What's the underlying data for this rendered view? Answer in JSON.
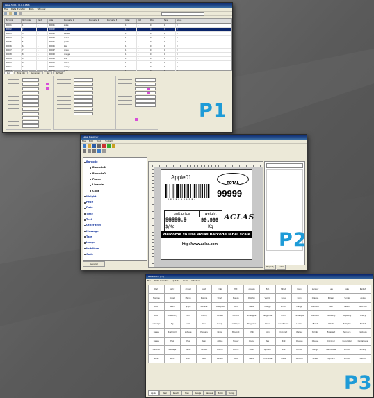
{
  "colors": {
    "background": "#5e5e5e",
    "accent_label": "#1e9bd7",
    "titlebar": "#0a246a"
  },
  "p1": {
    "label": "P1",
    "window_title": "Label.5 (P1) (6.0.0.186)",
    "menu": [
      "File",
      "Data Transfer",
      "Tools",
      "Window"
    ],
    "grid_headers": [
      "PLU code",
      "Item code",
      "Dept",
      "Code",
      "PLU name 1",
      "PLU name 2",
      "PLU name 3",
      "Index",
      "Unit",
      "Price",
      "Tare",
      "Group"
    ],
    "grid_rows": [
      [
        "000001",
        "1",
        "1",
        "000001",
        "apple",
        "",
        "",
        "1",
        "1",
        "0",
        "0",
        "0"
      ],
      [
        "000002",
        "2",
        "1",
        "000002",
        "pear",
        "",
        "",
        "1",
        "1",
        "0",
        "0",
        "0"
      ],
      [
        "000003",
        "3",
        "1",
        "000003",
        "banana",
        "",
        "",
        "1",
        "1",
        "0",
        "0",
        "0"
      ],
      [
        "000004",
        "4",
        "1",
        "000004",
        "melon",
        "",
        "",
        "1",
        "1",
        "0",
        "0",
        "0"
      ],
      [
        "000005",
        "5",
        "1",
        "000005",
        "peach",
        "",
        "",
        "1",
        "1",
        "0",
        "0",
        "0"
      ],
      [
        "000006",
        "6",
        "1",
        "000006",
        "kiwi",
        "",
        "",
        "1",
        "1",
        "0",
        "0",
        "0"
      ],
      [
        "000007",
        "7",
        "1",
        "000007",
        "grape",
        "",
        "",
        "1",
        "1",
        "0",
        "0",
        "0"
      ],
      [
        "000008",
        "8",
        "1",
        "000008",
        "orange",
        "",
        "",
        "1",
        "1",
        "0",
        "0",
        "0"
      ],
      [
        "000009",
        "9",
        "1",
        "000009",
        "lime",
        "",
        "",
        "1",
        "1",
        "0",
        "0",
        "0"
      ],
      [
        "000010",
        "10",
        "1",
        "000010",
        "lemon",
        "",
        "",
        "1",
        "1",
        "0",
        "0",
        "0"
      ],
      [
        "000011",
        "11",
        "1",
        "000011",
        "cherry",
        "",
        "",
        "1",
        "1",
        "0",
        "0",
        "0"
      ],
      [
        "000012",
        "12",
        "1",
        "000012",
        "plum",
        "",
        "",
        "1",
        "1",
        "0",
        "0",
        "0"
      ],
      [
        "000013",
        "13",
        "1",
        "000013",
        "fig",
        "",
        "",
        "1",
        "1",
        "0",
        "0",
        "0"
      ]
    ],
    "tabs": [
      "PLU",
      "More info",
      "Advanced",
      "Nut",
      "Ref text"
    ]
  },
  "p2": {
    "label": "P2",
    "window_title": "Label Designer",
    "menu": [
      "File",
      "Edit",
      "Tools",
      "System"
    ],
    "tree": [
      {
        "text": "Barcode",
        "sub": false
      },
      {
        "text": "Barcode1",
        "sub": true
      },
      {
        "text": "Barcode2",
        "sub": true
      },
      {
        "text": "Frame",
        "sub": true
      },
      {
        "text": "Lineode",
        "sub": true
      },
      {
        "text": "Code",
        "sub": true
      },
      {
        "text": "Weight",
        "sub": false
      },
      {
        "text": "Price",
        "sub": false
      },
      {
        "text": "Date",
        "sub": false
      },
      {
        "text": "Time",
        "sub": false
      },
      {
        "text": "Text",
        "sub": false
      },
      {
        "text": "Other text",
        "sub": false
      },
      {
        "text": "Message",
        "sub": false
      },
      {
        "text": "Tare",
        "sub": false
      },
      {
        "text": "Image",
        "sub": false
      },
      {
        "text": "Nutrition",
        "sub": false
      },
      {
        "text": "Code",
        "sub": false
      }
    ],
    "tree_button": "General",
    "label_card": {
      "product": "Apple01",
      "total_caption": "TOTAL",
      "total_value": "99999",
      "barcode_number": "9 9 7 9 8 1 6 1 8 9 4",
      "unit_price_caption": "unit price",
      "weight_caption": "weight",
      "unit_price_value": "99999.9",
      "unit_price_unit": "$/Kg",
      "weight_value": "99.999",
      "weight_unit": "Kg",
      "logo": "ACLAS",
      "welcome": "Welcome to use Aclas barcode label scale",
      "url": "http://www.aclas.com"
    },
    "right_tabs": [
      "Property",
      "Label"
    ]
  },
  "p3": {
    "label": "P3",
    "window_title": "Label Lock (P3)",
    "menu": [
      "File",
      "Data Transfer",
      "Update",
      "Tools",
      "Window"
    ],
    "cells": [
      "Dish",
      "garlic",
      "mixed",
      "tahiti",
      "crab",
      "Hilt",
      "orange",
      "fish",
      "Milod",
      "liqoo",
      "parsley",
      "pea",
      "kale",
      "Radish",
      "Marrow",
      "mixed",
      "Maron",
      "Malone",
      "Shark",
      "Mango",
      "Dolphin",
      "Vanilla",
      "Rose",
      "Corn",
      "Orange",
      "Parsley",
      "Turnip",
      "Apple",
      "Pear",
      "peach",
      "grape",
      "banana",
      "pineapple",
      "plum",
      "melon",
      "orange",
      "lemon",
      "mango",
      "Avocado",
      "Pear",
      "Peach",
      "Avocado",
      "Pear",
      "Strawberry",
      "Plum",
      "Cherry",
      "Tomato",
      "Apricot",
      "Pineapple",
      "Tangerine",
      "Plum",
      "Pineapple",
      "Avocado",
      "blueberry",
      "raspberry",
      "cherry",
      "cabbage",
      "fig",
      "Leek",
      "chive",
      "turnip",
      "cabbage",
      "Tangerine",
      "Carrot",
      "Cauliflower",
      "Lemon",
      "Bread",
      "Potato",
      "Pumpkin",
      "Radish",
      "Celery",
      "Mushroom",
      "Lettuce",
      "Peppers",
      "Onion",
      "Broccoli",
      "Chili",
      "Corn",
      "Coconut",
      "Walnut",
      "tomato",
      "Eggplant",
      "Spinach",
      "cabbage",
      "Celery",
      "Egg",
      "Pea",
      "Bean",
      "coffee",
      "Honey",
      "Cocoa",
      "tea",
      "Mint",
      "Cheese",
      "Cheese",
      "Coconut",
      "Cucumber",
      "Cantaloupe",
      "Celeriac",
      "Sausage",
      "Lamb",
      "Tomato",
      "Cherry",
      "Cherry",
      "Salad",
      "Spinach",
      "Mint",
      "Lemon",
      "Mango",
      "Lemonade",
      "Tomato",
      "Shrimp",
      "Garlic",
      "Garlic",
      "Dish",
      "Pasta",
      "Lemon",
      "Pasta",
      "Lamb",
      "Chocolate",
      "Pizza",
      "Salmon",
      "Bread",
      "Spinach",
      "Tomato",
      "Lemon",
      "Honey",
      "Jelly",
      "Salmon",
      "Pepper",
      "Lettuce",
      "Shrimp",
      "Pear",
      "Cake",
      "Butter",
      "Fish",
      "Cherry",
      "Lemon",
      "Apple",
      "",
      "",
      "",
      "",
      "",
      "",
      "",
      "",
      "",
      "",
      "",
      "",
      "",
      "",
      "",
      "",
      "",
      "",
      "",
      "",
      "",
      "",
      "",
      "",
      "",
      "",
      "",
      "",
      "",
      "",
      "",
      "",
      "",
      "",
      "",
      "",
      "",
      "",
      ""
    ],
    "bottom_tabs": [
      "Apple",
      "Pear",
      "Peach",
      "Fish",
      "Grape",
      "Banana",
      "Melon",
      "Turnip"
    ]
  }
}
